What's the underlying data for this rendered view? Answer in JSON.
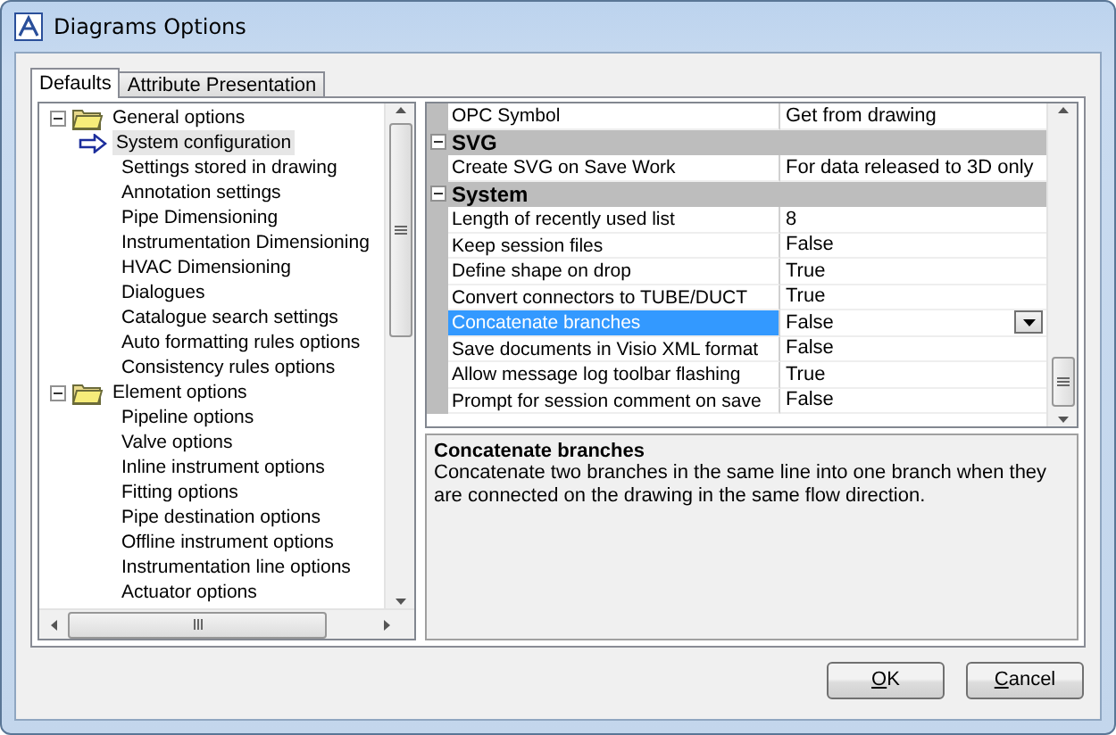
{
  "window": {
    "title": "Diagrams Options"
  },
  "tabs": [
    {
      "label": "Defaults",
      "selected": true
    },
    {
      "label": "Attribute Presentation",
      "selected": false
    }
  ],
  "tree": [
    {
      "label": "General options",
      "expanded": true,
      "children": [
        {
          "label": "System configuration",
          "selected": true
        },
        {
          "label": "Settings stored in drawing",
          "selected": false
        },
        {
          "label": "Annotation settings",
          "selected": false
        },
        {
          "label": "Pipe Dimensioning",
          "selected": false
        },
        {
          "label": "Instrumentation Dimensioning",
          "selected": false
        },
        {
          "label": "HVAC Dimensioning",
          "selected": false
        },
        {
          "label": "Dialogues",
          "selected": false
        },
        {
          "label": "Catalogue search settings",
          "selected": false
        },
        {
          "label": "Auto formatting rules options",
          "selected": false
        },
        {
          "label": "Consistency rules options",
          "selected": false
        }
      ]
    },
    {
      "label": "Element options",
      "expanded": true,
      "children": [
        {
          "label": "Pipeline options",
          "selected": false
        },
        {
          "label": "Valve options",
          "selected": false
        },
        {
          "label": "Inline instrument options",
          "selected": false
        },
        {
          "label": "Fitting options",
          "selected": false
        },
        {
          "label": "Pipe destination options",
          "selected": false
        },
        {
          "label": "Offline instrument options",
          "selected": false
        },
        {
          "label": "Instrumentation line options",
          "selected": false
        },
        {
          "label": "Actuator options",
          "selected": false
        }
      ]
    }
  ],
  "grid": [
    {
      "kind": "row",
      "name": "OPC Symbol",
      "value": "Get from drawing",
      "selected": false
    },
    {
      "kind": "section",
      "name": "SVG",
      "expanded": true
    },
    {
      "kind": "row",
      "name": "Create SVG on Save Work",
      "value": "For data released to 3D only",
      "selected": false
    },
    {
      "kind": "section",
      "name": "System",
      "expanded": true
    },
    {
      "kind": "row",
      "name": "Length of recently used list",
      "value": "8",
      "selected": false
    },
    {
      "kind": "row",
      "name": "Keep session files",
      "value": "False",
      "selected": false
    },
    {
      "kind": "row",
      "name": "Define shape on drop",
      "value": "True",
      "selected": false
    },
    {
      "kind": "row",
      "name": "Convert connectors to TUBE/DUCT",
      "value": "True",
      "selected": false
    },
    {
      "kind": "row",
      "name": "Concatenate branches",
      "value": "False",
      "selected": true
    },
    {
      "kind": "row",
      "name": "Save documents in Visio XML format",
      "value": "False",
      "selected": false
    },
    {
      "kind": "row",
      "name": "Allow message log toolbar flashing",
      "value": "True",
      "selected": false
    },
    {
      "kind": "row",
      "name": "Prompt for session comment on save",
      "value": "False",
      "selected": false
    }
  ],
  "description": {
    "title": "Concatenate branches",
    "text": "Concatenate two branches in the same line into one branch when they are connected on the drawing in the same flow direction."
  },
  "buttons": [
    "OK",
    "Cancel"
  ]
}
